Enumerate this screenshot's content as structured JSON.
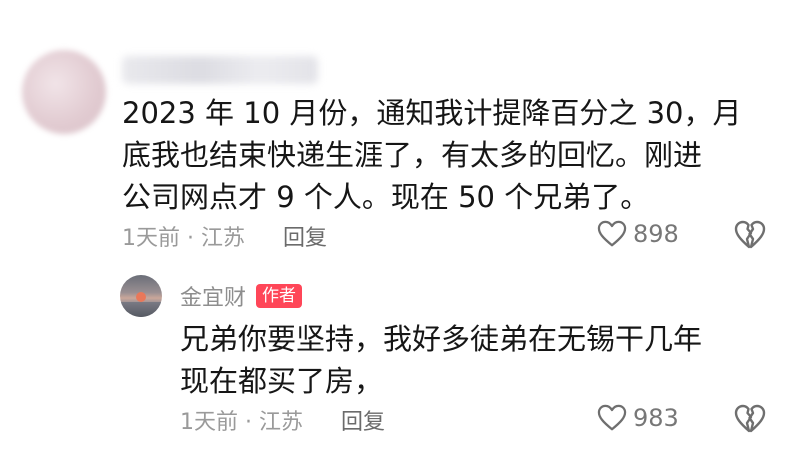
{
  "comment": {
    "text_lines": [
      "2023 年 10 月份，通知我计提降百分之 30，月",
      "底我也结束快递生涯了，有太多的回忆。刚进",
      "公司网点才 9 个人。现在 50 个兄弟了。"
    ],
    "time_location": "1天前 · 江苏",
    "reply_label": "回复",
    "like_count": "898"
  },
  "reply": {
    "author": "金宜财",
    "author_badge": "作者",
    "text_lines": [
      "兄弟你要坚持，我好多徒弟在无锡干几年",
      "现在都买了房，"
    ],
    "time_location": "1天前 · 江苏",
    "reply_label": "回复",
    "like_count": "983"
  },
  "colors": {
    "badge": "#ff4658",
    "text": "#161616",
    "meta": "#9a9a9a"
  },
  "icons": {
    "like": "heart-outline-icon",
    "dislike": "broken-heart-icon"
  }
}
